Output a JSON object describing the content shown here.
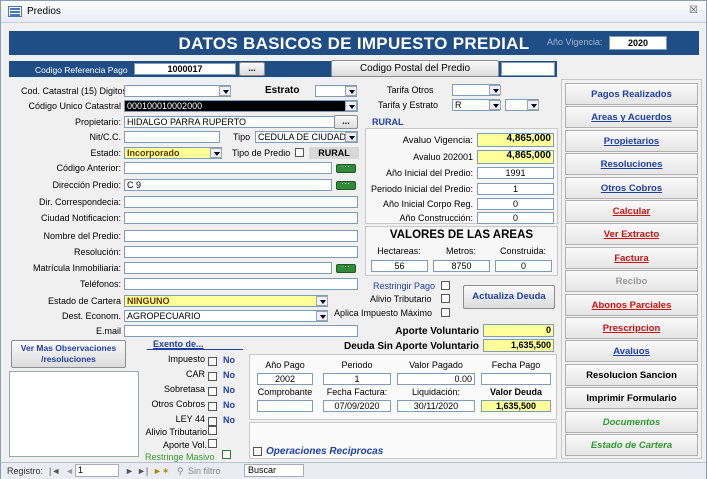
{
  "window": {
    "title": "Predios",
    "close": "☒"
  },
  "header": {
    "title": "DATOS BASICOS DE IMPUESTO PREDIAL",
    "vigencia_label": "Año Vigencia:",
    "vigencia_value": "2020"
  },
  "ref": {
    "label": "Codigo Referencia Pago",
    "value": "1000017",
    "btn": "...",
    "postal_btn": "Codigo Postal del Predio",
    "postal_value": ""
  },
  "form": {
    "cod_catastral_label": "Cod. Catastral (15) Digitos",
    "cod_catastral_value": "",
    "estrato_label": "Estrato",
    "estrato_value": "",
    "cod_unico_label": "Código Unico Catastral",
    "cod_unico_value": "000100010002000",
    "tarifa_otros_label": "Tarifa Otros",
    "tarifa_otros_value": "",
    "tarifa_estrato_label": "Tarifa y Estrato",
    "tarifa_estrato_value": "R",
    "propietario_label": "Propietario:",
    "propietario_value": "HIDALGO PARRA RUPERTO",
    "prop_btn": "...",
    "rural": "RURAL",
    "nit_label": "Nit/C.C.",
    "nit_value": "",
    "tipo_label": "Tipo",
    "tipo_value": "CEDULA DE CIUDADA",
    "estado_label": "Estado:",
    "estado_value": "Incorporado",
    "tipo_predio_label": "Tipo de Predio",
    "tipo_predio_value": "RURAL",
    "cod_anterior_label": "Código Anterior:",
    "direccion_label": "Dirección Predio:",
    "direccion_value": "C 9",
    "dir_corr_label": "Dir. Correspondecia:",
    "ciudad_label": "Ciudad Notificacion:",
    "nombre_label": "Nombre del Predio:",
    "resolucion_label": "Resolución:",
    "matricula_label": "Matrícula Inmobiliaria:",
    "telefonos_label": "Teléfonos:",
    "estado_cartera_label": "Estado de Cartera",
    "estado_cartera_value": "NINGUNO",
    "dest_label": "Dest. Econom.",
    "dest_value": "AGROPECUARIO",
    "email_label": "E.mail"
  },
  "valores": {
    "avaluo_vig_label": "Avaluo Vigencia:",
    "avaluo_vig_value": "4,865,000",
    "avaluo_2020_label": "Avaluo 202001",
    "avaluo_2020_value": "4,865,000",
    "anio_inicial_label": "Año Inicial del  Predio:",
    "anio_inicial_value": "1991",
    "periodo_inicial_label": "Periodo Inicial del  Predio:",
    "periodo_inicial_value": "1",
    "corpo_label": "Año Inicial Corpo Reg.",
    "corpo_value": "0",
    "construccion_label": "Año Construcción:",
    "construccion_value": "0",
    "areas_title": "VALORES DE LAS AREAS",
    "hect_label": "Hectareas:",
    "metros_label": "Metros:",
    "construida_label": "Construida:",
    "hect_value": "56",
    "metros_value": "8750",
    "construida_value": "0",
    "restringir_label": "Restringir Pago",
    "alivio_label": "Alivio Tributario",
    "aplica_label": "Aplica Impuesto Máximo",
    "actualiza_btn": "Actualiza Deuda",
    "aporte_label": "Aporte Voluntario",
    "aporte_value": "0",
    "deuda_sin_label": "Deuda Sin Aporte Voluntario",
    "deuda_sin_value": "1,635,500"
  },
  "bottom": {
    "ver_obs_btn": "Ver Mas Observaciones /resoluciones",
    "exento_label": "Exento de...",
    "exentos": [
      {
        "label": "Impuesto",
        "value": "No"
      },
      {
        "label": "CAR",
        "value": "No"
      },
      {
        "label": "Sobretasa",
        "value": "No"
      },
      {
        "label": "Otros Cobros",
        "value": "No"
      },
      {
        "label": "LEY 44",
        "value": "No"
      }
    ],
    "alivio_label": "Alivio Tributario",
    "aporte_label": "Aporte Vol.",
    "restringe_label": "Restringe Masivo",
    "pago_headers": [
      "Año Pago",
      "Periodo",
      "Valor Pagado",
      "Fecha Pago"
    ],
    "pago_values": [
      "2002",
      "1",
      "0.00",
      ""
    ],
    "liq_headers": [
      "Comprobante",
      "Fecha Factura:",
      "Liquidación:",
      "Valor Deuda"
    ],
    "liq_values": [
      "",
      "07/09/2020",
      "30/11/2020",
      "1,635,500"
    ],
    "operaciones_label": "Operaciones Reciprocas"
  },
  "nav": [
    {
      "label": "Pagos Realizados",
      "color": "#1f3fa5",
      "underline": false
    },
    {
      "label": "Areas y Acuerdos",
      "color": "#1f3fa5",
      "underline": true
    },
    {
      "label": "Propietarios",
      "color": "#1f3fa5",
      "underline": true
    },
    {
      "label": "Resoluciones",
      "color": "#1f3fa5",
      "underline": true
    },
    {
      "label": "Otros Cobros",
      "color": "#1f3fa5",
      "underline": true
    },
    {
      "label": "Calcular",
      "color": "#cc1111",
      "underline": true
    },
    {
      "label": "Ver Extracto",
      "color": "#cc1111",
      "underline": true
    },
    {
      "label": "Factura",
      "color": "#cc1111",
      "underline": true
    },
    {
      "label": "Recibo",
      "color": "#999999",
      "underline": false
    },
    {
      "label": "Abonos Parciales",
      "color": "#cc1111",
      "underline": true
    },
    {
      "label": "Prescripcion",
      "color": "#cc1111",
      "underline": true
    },
    {
      "label": "Avaluos",
      "color": "#1f3fa5",
      "underline": true
    },
    {
      "label": "Resolucion Sancion",
      "color": "#000000",
      "underline": false
    },
    {
      "label": "Imprimir Formulario",
      "color": "#000000",
      "underline": false
    },
    {
      "label": "Documentos",
      "color": "#2e9a2e",
      "underline": false
    },
    {
      "label": "Estado de Cartera",
      "color": "#2e9a2e",
      "underline": false
    }
  ],
  "status": {
    "registro": "Registro:",
    "record": "1",
    "sin_filtro": "Sin filtro",
    "buscar": "Buscar"
  }
}
